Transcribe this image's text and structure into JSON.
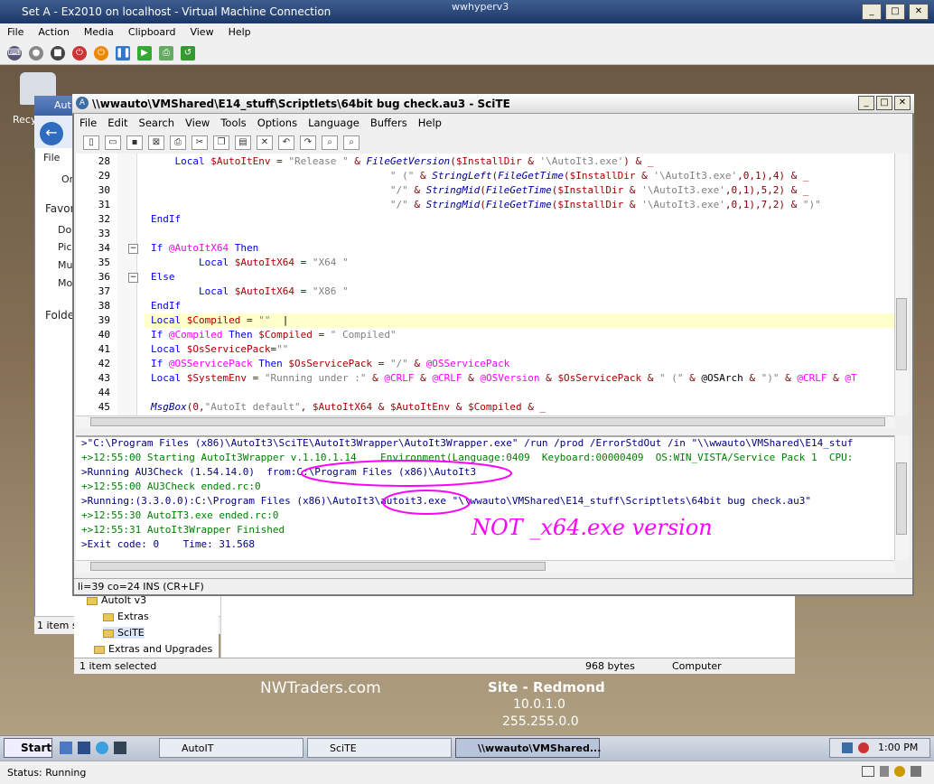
{
  "outer_window": {
    "title": "Set A - Ex2010 on localhost - Virtual Machine Connection",
    "caption": "wwhyperv3",
    "menu": [
      "File",
      "Action",
      "Media",
      "Clipboard",
      "View",
      "Help"
    ]
  },
  "desktop": {
    "recycle_label": "Recy",
    "nwtraders": "NWTraders.com",
    "site": "Site - Redmond",
    "ip": "10.0.1.0",
    "mask": "255.255.0.0"
  },
  "explorer": {
    "title": "Aut",
    "file": "File",
    "org": "Or",
    "favorites": "Favori",
    "items": [
      "Do",
      "Pic",
      "Mu",
      "Mo"
    ],
    "folders": "Folde",
    "status": "1 item s",
    "tree": [
      "AutoIt v3",
      "Extras",
      "SciTE",
      "Extras and Upgrades"
    ],
    "bottom_selected": "1 item selected",
    "bottom_size": "968 bytes",
    "bottom_location": "Computer"
  },
  "scite": {
    "title": "\\\\wwauto\\VMShared\\E14_stuff\\Scriptlets\\64bit bug check.au3 - SciTE",
    "menu": [
      "File",
      "Edit",
      "Search",
      "View",
      "Tools",
      "Options",
      "Language",
      "Buffers",
      "Help"
    ],
    "status": "li=39 co=24 INS (CR+LF)",
    "line_numbers": [
      "28",
      "29",
      "30",
      "31",
      "32",
      "33",
      "34",
      "35",
      "36",
      "37",
      "38",
      "39",
      "40",
      "41",
      "42",
      "43",
      "44",
      "45"
    ],
    "output": [
      ">\"C:\\Program Files (x86)\\AutoIt3\\SciTE\\AutoIt3Wrapper\\AutoIt3Wrapper.exe\" /run /prod /ErrorStdOut /in \"\\\\wwauto\\VMShared\\E14_stuf",
      "+>12:55:00 Starting AutoIt3Wrapper v.1.10.1.14    Environment(Language:0409  Keyboard:00000409  OS:WIN_VISTA/Service Pack 1  CPU:",
      ">Running AU3Check (1.54.14.0)  from:C:\\Program Files (x86)\\AutoIt3",
      "+>12:55:00 AU3Check ended.rc:0",
      ">Running:(3.3.0.0):C:\\Program Files (x86)\\AutoIt3\\autoit3.exe \"\\\\wwauto\\VMShared\\E14_stuff\\Scriptlets\\64bit bug check.au3\"",
      "+>12:55:30 AutoIT3.exe ended.rc:0",
      "+>12:55:31 AutoIt3Wrapper Finished",
      ">Exit code: 0    Time: 31.568"
    ]
  },
  "annotation": "NOT _x64.exe version",
  "taskbar": {
    "start": "Start",
    "tasks": [
      "AutoIT",
      "SciTE",
      "\\\\wwauto\\VMShared..."
    ],
    "clock": "1:00 PM"
  },
  "vm_status": "Status: Running"
}
